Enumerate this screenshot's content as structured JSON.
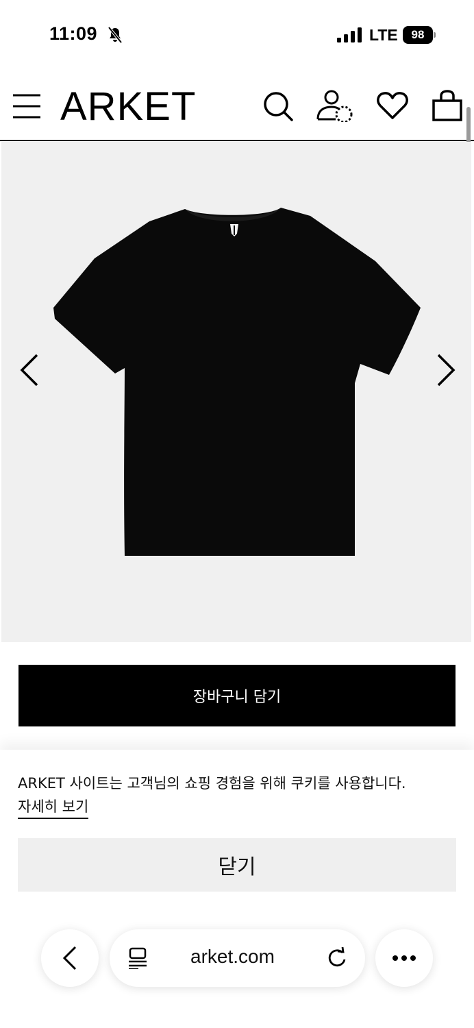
{
  "status_bar": {
    "time": "11:09",
    "network": "LTE",
    "battery": "98"
  },
  "header": {
    "logo": "ARKET"
  },
  "product": {
    "add_to_bag_label": "장바구니 담기"
  },
  "cookie_banner": {
    "message": "ARKET 사이트는 고객님의 쇼핑 경험을 위해 쿠키를 사용합니다.",
    "details_link": "자세히 보기",
    "close_label": "닫기"
  },
  "browser": {
    "url": "arket.com"
  },
  "icons": {
    "menu": "menu-icon",
    "search": "search-icon",
    "account": "account-icon",
    "wishlist": "heart-icon",
    "bag": "shopping-bag-icon"
  },
  "colors": {
    "brand": "#000000",
    "gallery_bg": "#f0f0f0",
    "close_button_bg": "#efefef"
  }
}
